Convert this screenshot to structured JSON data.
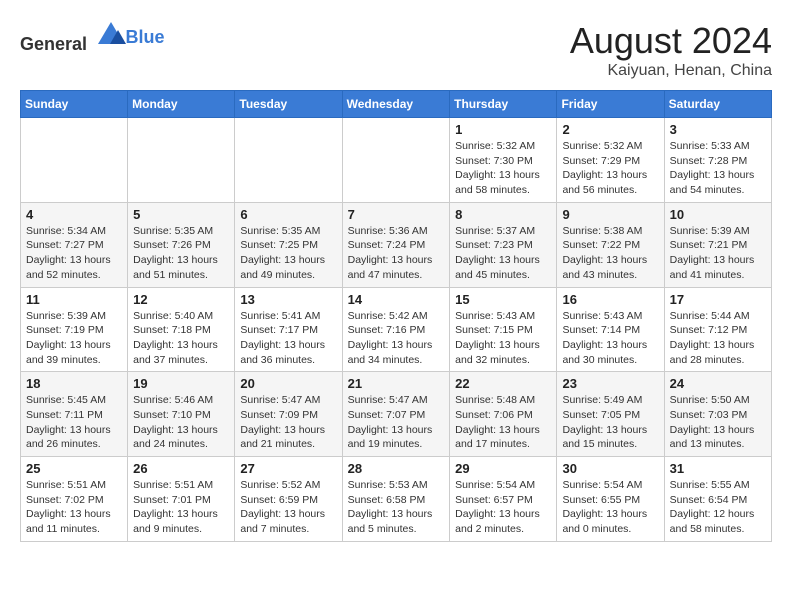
{
  "header": {
    "logo": {
      "text_general": "General",
      "text_blue": "Blue"
    },
    "title": "August 2024",
    "location": "Kaiyuan, Henan, China"
  },
  "days_of_week": [
    "Sunday",
    "Monday",
    "Tuesday",
    "Wednesday",
    "Thursday",
    "Friday",
    "Saturday"
  ],
  "weeks": [
    [
      {
        "day": "",
        "info": ""
      },
      {
        "day": "",
        "info": ""
      },
      {
        "day": "",
        "info": ""
      },
      {
        "day": "",
        "info": ""
      },
      {
        "day": "1",
        "info": "Sunrise: 5:32 AM\nSunset: 7:30 PM\nDaylight: 13 hours and 58 minutes."
      },
      {
        "day": "2",
        "info": "Sunrise: 5:32 AM\nSunset: 7:29 PM\nDaylight: 13 hours and 56 minutes."
      },
      {
        "day": "3",
        "info": "Sunrise: 5:33 AM\nSunset: 7:28 PM\nDaylight: 13 hours and 54 minutes."
      }
    ],
    [
      {
        "day": "4",
        "info": "Sunrise: 5:34 AM\nSunset: 7:27 PM\nDaylight: 13 hours and 52 minutes."
      },
      {
        "day": "5",
        "info": "Sunrise: 5:35 AM\nSunset: 7:26 PM\nDaylight: 13 hours and 51 minutes."
      },
      {
        "day": "6",
        "info": "Sunrise: 5:35 AM\nSunset: 7:25 PM\nDaylight: 13 hours and 49 minutes."
      },
      {
        "day": "7",
        "info": "Sunrise: 5:36 AM\nSunset: 7:24 PM\nDaylight: 13 hours and 47 minutes."
      },
      {
        "day": "8",
        "info": "Sunrise: 5:37 AM\nSunset: 7:23 PM\nDaylight: 13 hours and 45 minutes."
      },
      {
        "day": "9",
        "info": "Sunrise: 5:38 AM\nSunset: 7:22 PM\nDaylight: 13 hours and 43 minutes."
      },
      {
        "day": "10",
        "info": "Sunrise: 5:39 AM\nSunset: 7:21 PM\nDaylight: 13 hours and 41 minutes."
      }
    ],
    [
      {
        "day": "11",
        "info": "Sunrise: 5:39 AM\nSunset: 7:19 PM\nDaylight: 13 hours and 39 minutes."
      },
      {
        "day": "12",
        "info": "Sunrise: 5:40 AM\nSunset: 7:18 PM\nDaylight: 13 hours and 37 minutes."
      },
      {
        "day": "13",
        "info": "Sunrise: 5:41 AM\nSunset: 7:17 PM\nDaylight: 13 hours and 36 minutes."
      },
      {
        "day": "14",
        "info": "Sunrise: 5:42 AM\nSunset: 7:16 PM\nDaylight: 13 hours and 34 minutes."
      },
      {
        "day": "15",
        "info": "Sunrise: 5:43 AM\nSunset: 7:15 PM\nDaylight: 13 hours and 32 minutes."
      },
      {
        "day": "16",
        "info": "Sunrise: 5:43 AM\nSunset: 7:14 PM\nDaylight: 13 hours and 30 minutes."
      },
      {
        "day": "17",
        "info": "Sunrise: 5:44 AM\nSunset: 7:12 PM\nDaylight: 13 hours and 28 minutes."
      }
    ],
    [
      {
        "day": "18",
        "info": "Sunrise: 5:45 AM\nSunset: 7:11 PM\nDaylight: 13 hours and 26 minutes."
      },
      {
        "day": "19",
        "info": "Sunrise: 5:46 AM\nSunset: 7:10 PM\nDaylight: 13 hours and 24 minutes."
      },
      {
        "day": "20",
        "info": "Sunrise: 5:47 AM\nSunset: 7:09 PM\nDaylight: 13 hours and 21 minutes."
      },
      {
        "day": "21",
        "info": "Sunrise: 5:47 AM\nSunset: 7:07 PM\nDaylight: 13 hours and 19 minutes."
      },
      {
        "day": "22",
        "info": "Sunrise: 5:48 AM\nSunset: 7:06 PM\nDaylight: 13 hours and 17 minutes."
      },
      {
        "day": "23",
        "info": "Sunrise: 5:49 AM\nSunset: 7:05 PM\nDaylight: 13 hours and 15 minutes."
      },
      {
        "day": "24",
        "info": "Sunrise: 5:50 AM\nSunset: 7:03 PM\nDaylight: 13 hours and 13 minutes."
      }
    ],
    [
      {
        "day": "25",
        "info": "Sunrise: 5:51 AM\nSunset: 7:02 PM\nDaylight: 13 hours and 11 minutes."
      },
      {
        "day": "26",
        "info": "Sunrise: 5:51 AM\nSunset: 7:01 PM\nDaylight: 13 hours and 9 minutes."
      },
      {
        "day": "27",
        "info": "Sunrise: 5:52 AM\nSunset: 6:59 PM\nDaylight: 13 hours and 7 minutes."
      },
      {
        "day": "28",
        "info": "Sunrise: 5:53 AM\nSunset: 6:58 PM\nDaylight: 13 hours and 5 minutes."
      },
      {
        "day": "29",
        "info": "Sunrise: 5:54 AM\nSunset: 6:57 PM\nDaylight: 13 hours and 2 minutes."
      },
      {
        "day": "30",
        "info": "Sunrise: 5:54 AM\nSunset: 6:55 PM\nDaylight: 13 hours and 0 minutes."
      },
      {
        "day": "31",
        "info": "Sunrise: 5:55 AM\nSunset: 6:54 PM\nDaylight: 12 hours and 58 minutes."
      }
    ]
  ]
}
